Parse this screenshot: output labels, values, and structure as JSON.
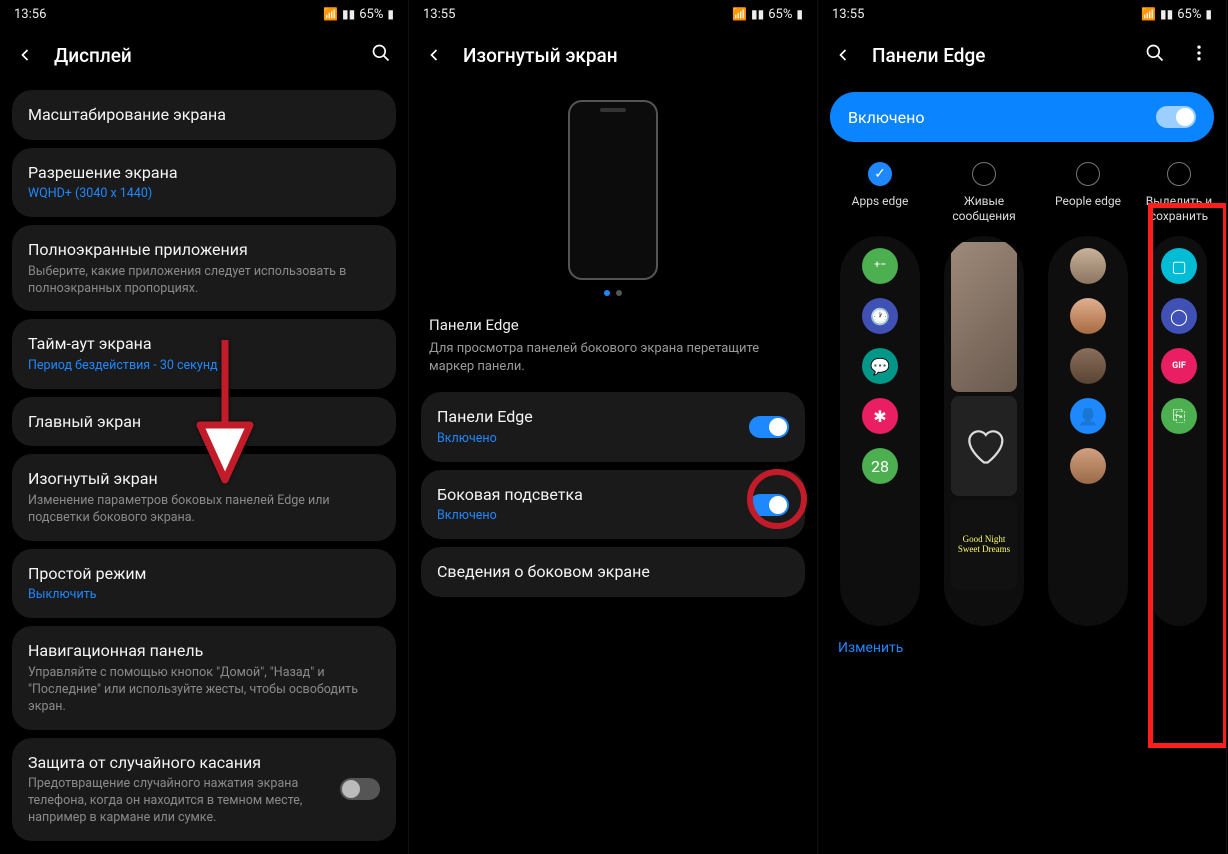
{
  "status": {
    "time1": "13:56",
    "time2": "13:55",
    "time3": "13:55",
    "battery": "65%"
  },
  "s1": {
    "title": "Дисплей",
    "items": {
      "scale": "Масштабирование экрана",
      "res_t": "Разрешение экрана",
      "res_s": "WQHD+ (3040 x 1440)",
      "full_t": "Полноэкранные приложения",
      "full_s": "Выберите, какие приложения следует использовать в полноэкранных пропорциях.",
      "timeout_t": "Тайм-аут экрана",
      "timeout_s": "Период бездействия - 30 секунд",
      "home": "Главный экран",
      "edge_t": "Изогнутый экран",
      "edge_s": "Изменение параметров боковых панелей Edge или подсветки бокового экрана.",
      "simple_t": "Простой режим",
      "simple_s": "Выключить",
      "nav_t": "Навигационная панель",
      "nav_s": "Управляйте с помощью кнопок \"Домой\", \"Назад\" и \"Последние\" или используйте жесты, чтобы освободить экран.",
      "touch_t": "Защита от случайного касания",
      "touch_s": "Предотвращение случайного нажатия экрана телефона, когда он находится в темном месте, например в кармане или сумке."
    }
  },
  "s2": {
    "title": "Изогнутый экран",
    "desc_title": "Панели Edge",
    "desc_text": "Для просмотра панелей бокового экрана перетащите маркер панели.",
    "panels_t": "Панели Edge",
    "panels_s": "Включено",
    "light_t": "Боковая подсветка",
    "light_s": "Включено",
    "about": "Сведения о боковом экране"
  },
  "s3": {
    "title": "Панели Edge",
    "enabled": "Включено",
    "labels": {
      "apps": "Apps edge",
      "live": "Живые сообщения",
      "people": "People edge",
      "crop": "Выделить и сохранить"
    },
    "edit": "Изменить",
    "goodnight": "Good Night Sweet Dreams"
  }
}
